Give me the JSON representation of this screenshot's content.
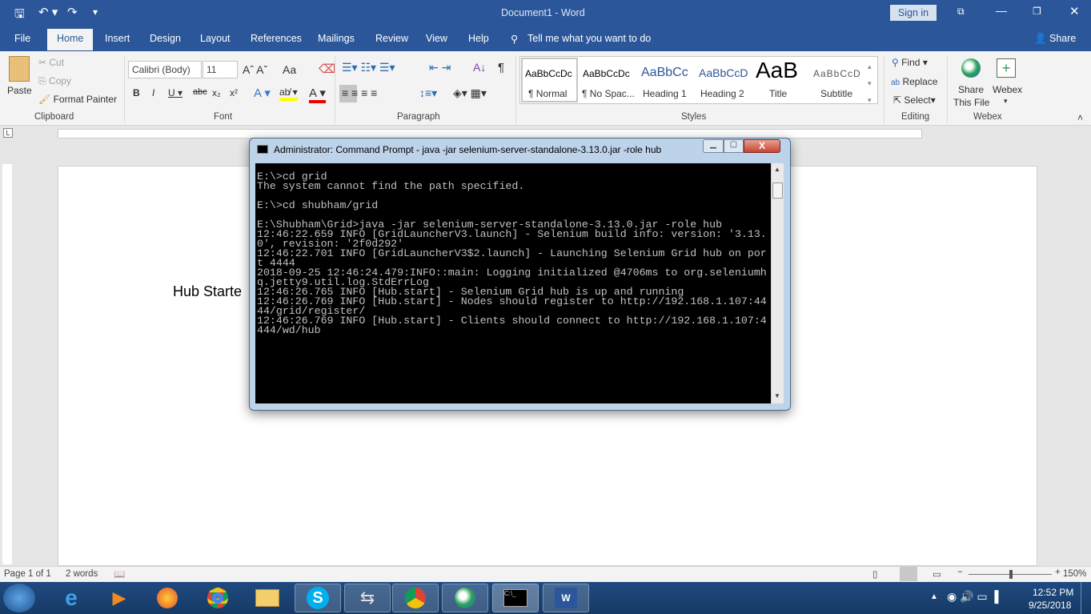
{
  "word": {
    "title": "Document1  -  Word",
    "sign_in": "Sign in",
    "tabs": [
      "File",
      "Home",
      "Insert",
      "Design",
      "Layout",
      "References",
      "Mailings",
      "Review",
      "View",
      "Help"
    ],
    "tell_me": "Tell me what you want to do",
    "share": "Share",
    "clipboard": {
      "paste": "Paste",
      "cut": "Cut",
      "copy": "Copy",
      "format_painter": "Format Painter",
      "label": "Clipboard"
    },
    "font": {
      "name": "Calibri (Body)",
      "size": "11",
      "label": "Font",
      "case": "Aa"
    },
    "paragraph": {
      "label": "Paragraph"
    },
    "styles": {
      "items": [
        {
          "preview": "AaBbCcDc",
          "name": "¶ Normal"
        },
        {
          "preview": "AaBbCcDc",
          "name": "¶ No Spac..."
        },
        {
          "preview": "AaBbCc",
          "name": "Heading 1"
        },
        {
          "preview": "AaBbCcD",
          "name": "Heading 2"
        },
        {
          "preview": "AaB",
          "name": "Title"
        },
        {
          "preview": "AaBbCcD",
          "name": "Subtitle"
        }
      ],
      "label": "Styles"
    },
    "editing": {
      "find": "Find",
      "replace": "Replace",
      "select": "Select",
      "label": "Editing"
    },
    "webex": {
      "share": "Share",
      "share2": "This File",
      "webex": "Webex",
      "label": "Webex"
    },
    "document_text": "Hub Starte",
    "status": {
      "page": "Page 1 of 1",
      "words": "2 words",
      "zoom": "150%"
    }
  },
  "cmd": {
    "title": "Administrator: Command Prompt - java  -jar selenium-server-standalone-3.13.0.jar -role hub",
    "lines": [
      "E:\\>cd grid",
      "The system cannot find the path specified.",
      "",
      "E:\\>cd shubham/grid",
      "",
      "E:\\Shubham\\Grid>java -jar selenium-server-standalone-3.13.0.jar -role hub",
      "12:46:22.659 INFO [GridLauncherV3.launch] - Selenium build info: version: '3.13.",
      "0', revision: '2f0d292'",
      "12:46:22.701 INFO [GridLauncherV3$2.launch] - Launching Selenium Grid hub on por",
      "t 4444",
      "2018-09-25 12:46:24.479:INFO::main: Logging initialized @4706ms to org.seleniumh",
      "q.jetty9.util.log.StdErrLog",
      "12:46:26.765 INFO [Hub.start] - Selenium Grid hub is up and running",
      "12:46:26.769 INFO [Hub.start] - Nodes should register to http://192.168.1.107:44",
      "44/grid/register/",
      "12:46:26.769 INFO [Hub.start] - Clients should connect to http://192.168.1.107:4",
      "444/wd/hub"
    ]
  },
  "taskbar": {
    "time": "12:52 PM",
    "date": "9/25/2018"
  }
}
